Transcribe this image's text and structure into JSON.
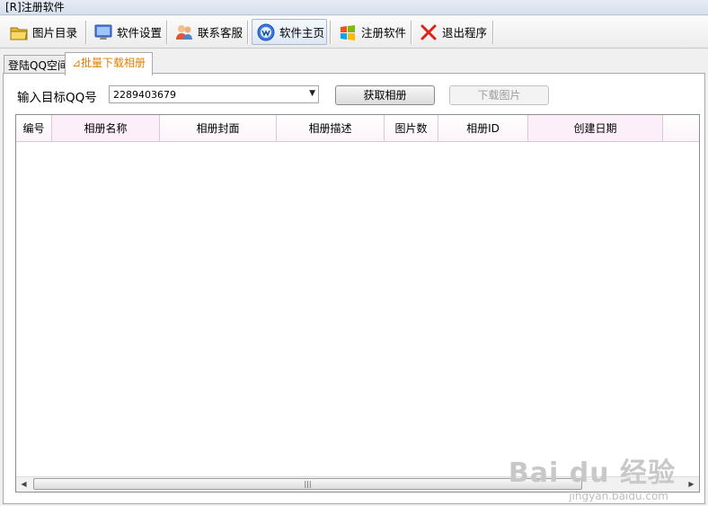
{
  "window": {
    "title": "[R]注册软件"
  },
  "toolbar": [
    {
      "label": "图片目录",
      "icon": "folder-icon"
    },
    {
      "label": "软件设置",
      "icon": "monitor-icon"
    },
    {
      "label": "联系客服",
      "icon": "people-icon"
    },
    {
      "label": "软件主页",
      "icon": "browser-icon"
    },
    {
      "label": "注册软件",
      "icon": "windows-logo-icon"
    },
    {
      "label": "退出程序",
      "icon": "red-x-icon"
    }
  ],
  "tabs": [
    {
      "label": "登陆QQ空间",
      "active": false
    },
    {
      "label": "⊿批量下载相册",
      "active": true
    }
  ],
  "form": {
    "qq_label": "输入目标QQ号",
    "qq_value": "2289403679",
    "fetch_button": "获取相册",
    "download_button": "下载图片"
  },
  "table": {
    "columns": [
      "编号",
      "相册名称",
      "相册封面",
      "相册描述",
      "图片数",
      "相册ID",
      "创建日期"
    ],
    "rows": []
  },
  "watermark": {
    "main": "Bai du 经验",
    "sub": "jingyan.baidu.com"
  }
}
